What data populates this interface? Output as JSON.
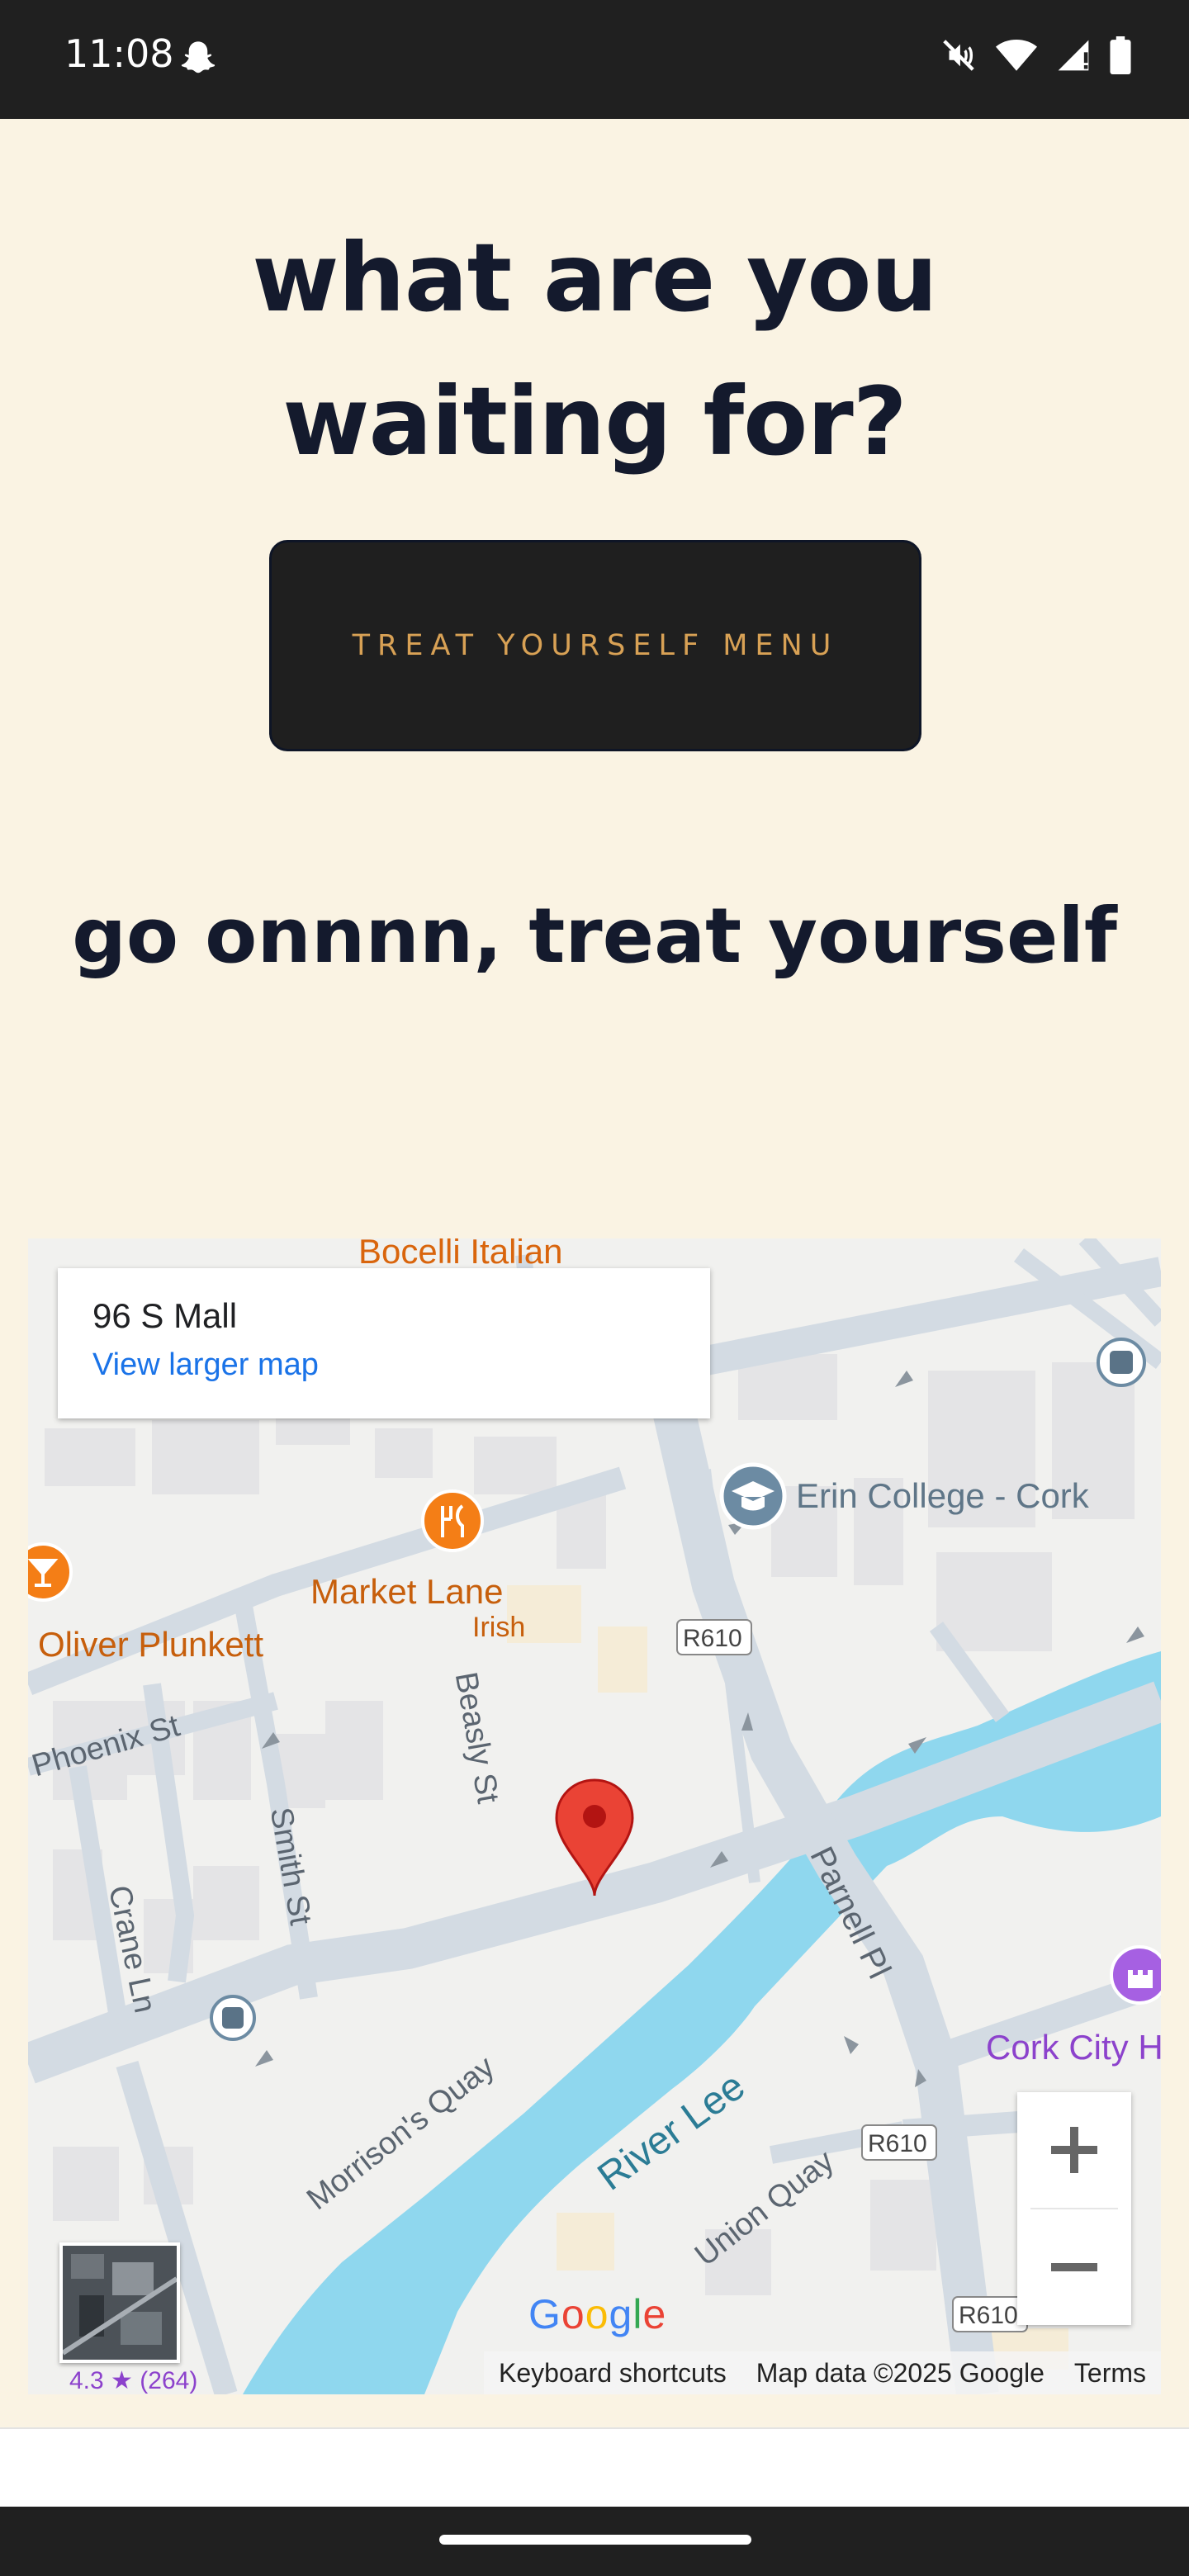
{
  "status_bar": {
    "time": "11:08"
  },
  "hero": {
    "title": "what are you waiting for?",
    "cta_label": "TREAT YOURSELF MENU",
    "subtitle": "go onnnn, treat yourself"
  },
  "map": {
    "card": {
      "address": "96 S Mall",
      "link": "View larger map"
    },
    "labels": {
      "top_restaurant": "Bocelli Italian",
      "erin_college": "Erin College - Cork",
      "market_lane": "Market Lane",
      "market_lane_type": "Irish",
      "oliver_plunkett": "Oliver Plunkett",
      "phoenix": "Phoenix St",
      "smith": "Smith St",
      "crane": "Crane Ln",
      "beasly": "Beasly St",
      "parnell": "Parnell Pl",
      "river": "River Lee",
      "morrisons": "Morrison's Quay",
      "union": "Union Quay",
      "cork_city": "Cork City H",
      "road_r610": "R610",
      "rating": "4.3 ★ (264)"
    },
    "footer": {
      "shortcuts": "Keyboard shortcuts",
      "data": "Map data ©2025 Google",
      "terms": "Terms"
    },
    "logo": "Google"
  }
}
